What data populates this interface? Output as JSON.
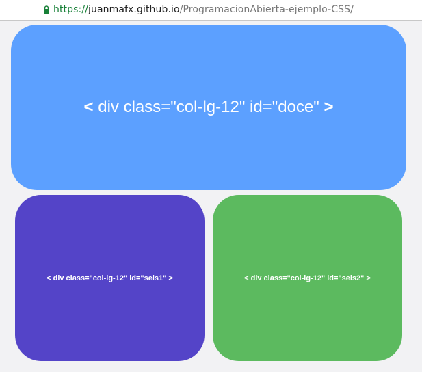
{
  "address_bar": {
    "scheme": "https://",
    "host": "juanmafx.github.io",
    "path": "/ProgramacionAbierta-ejemplo-CSS/"
  },
  "boxes": {
    "doce": {
      "open": "<",
      "label": " div class=\"col-lg-12\" id=\"doce\" ",
      "close": ">",
      "color": "#5ca0ff"
    },
    "seis1": {
      "text": "< div class=\"col-lg-12\" id=\"seis1\" >",
      "color": "#5444c8"
    },
    "seis2": {
      "text": "< div class=\"col-lg-12\" id=\"seis2\" >",
      "color": "#5cba5f"
    }
  },
  "icons": {
    "lock": "lock-icon",
    "lock_color": "#188038"
  }
}
